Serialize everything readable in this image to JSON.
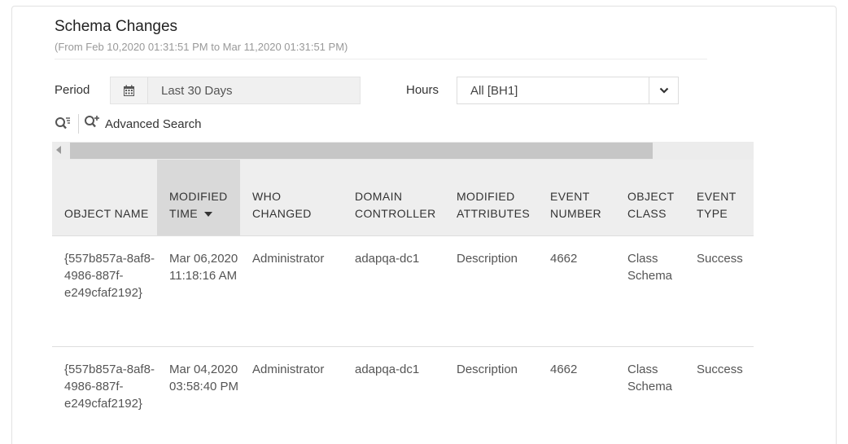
{
  "report": {
    "title": "Schema Changes",
    "subtitle": "(From Feb 10,2020 01:31:51 PM to Mar 11,2020 01:31:51 PM)"
  },
  "filters": {
    "period_label": "Period",
    "period_value": "Last 30 Days",
    "hours_label": "Hours",
    "hours_value": "All [BH1]"
  },
  "toolbar": {
    "advanced_search_label": "Advanced Search"
  },
  "icons": {
    "calendar": "calendar-icon",
    "dropdown": "chevron-down-icon",
    "filter": "filter-search-icon",
    "advanced_search": "search-plus-icon",
    "scroll_left": "arrow-left-icon"
  },
  "table": {
    "columns": [
      {
        "label": "OBJECT NAME"
      },
      {
        "label": "MODIFIED TIME",
        "sorted": "desc"
      },
      {
        "label": "WHO CHANGED"
      },
      {
        "label": "DOMAIN CONTROLLER"
      },
      {
        "label": "MODIFIED ATTRIBUTES"
      },
      {
        "label": "EVENT NUMBER"
      },
      {
        "label": "OBJECT CLASS"
      },
      {
        "label": "EVENT TYPE"
      }
    ],
    "rows": [
      [
        "{557b857a-8af8-4986-887f-e249cfaf2192}",
        "Mar 06,2020 11:18:16 AM",
        "Administrator",
        "adapqa-dc1",
        "Description",
        "4662",
        "Class Schema",
        "Success"
      ],
      [
        "{557b857a-8af8-4986-887f-e249cfaf2192}",
        "Mar 04,2020 03:58:40 PM",
        "Administrator",
        "adapqa-dc1",
        "Description",
        "4662",
        "Class Schema",
        "Success"
      ]
    ]
  },
  "colors": {
    "header_bg": "#eeeeee",
    "sorted_header_bg": "#d9d9d9",
    "scrollbar_thumb": "#c6c6c6"
  }
}
